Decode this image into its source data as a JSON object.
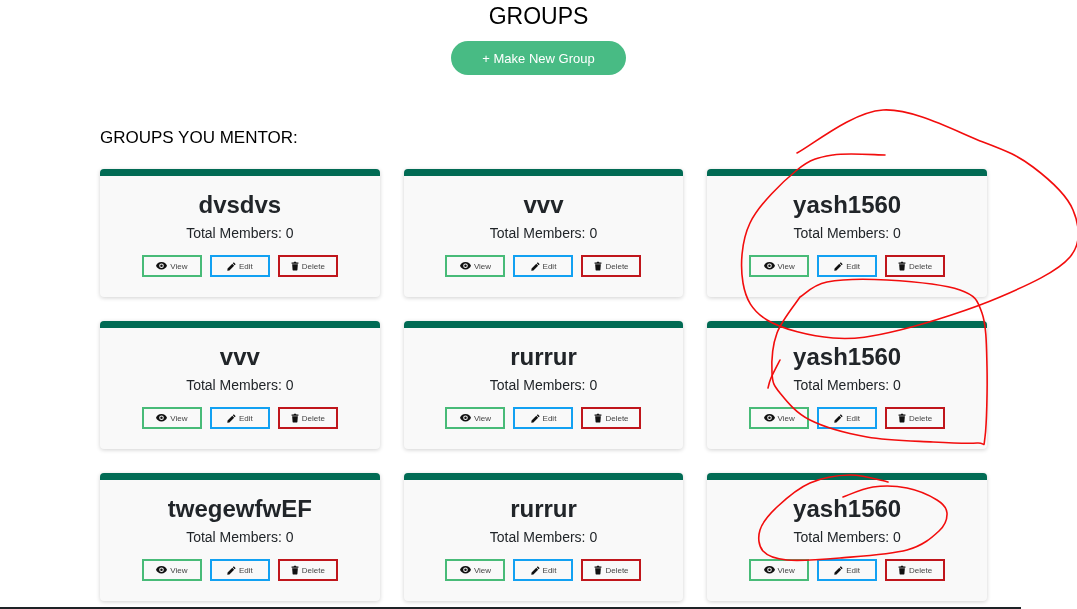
{
  "page": {
    "title": "GROUPS",
    "create_button": "+ Make New Group"
  },
  "section": {
    "heading": "GROUPS YOU MENTOR:"
  },
  "groups": [
    {
      "name": "dvsdvs",
      "members": "Total Members: 0",
      "circled": false,
      "actions": [
        {
          "kind": "view",
          "label": "View"
        },
        {
          "kind": "edit",
          "label": "Edit"
        },
        {
          "kind": "delete",
          "label": "Delete"
        }
      ]
    },
    {
      "name": "vvv",
      "members": "Total Members: 0",
      "circled": false,
      "actions": [
        {
          "kind": "view",
          "label": "View"
        },
        {
          "kind": "edit",
          "label": "Edit"
        },
        {
          "kind": "delete",
          "label": "Delete"
        }
      ]
    },
    {
      "name": "yash1560",
      "members": "Total Members: 0",
      "circled": true,
      "actions": [
        {
          "kind": "view",
          "label": "View"
        },
        {
          "kind": "edit",
          "label": "Edit"
        },
        {
          "kind": "delete",
          "label": "Delete"
        }
      ]
    },
    {
      "name": "vvv",
      "members": "Total Members: 0",
      "circled": false,
      "actions": [
        {
          "kind": "view",
          "label": "View"
        },
        {
          "kind": "edit",
          "label": "Edit"
        },
        {
          "kind": "delete",
          "label": "Delete"
        }
      ]
    },
    {
      "name": "rurrur",
      "members": "Total Members: 0",
      "circled": false,
      "actions": [
        {
          "kind": "view",
          "label": "View"
        },
        {
          "kind": "edit",
          "label": "Edit"
        },
        {
          "kind": "delete",
          "label": "Delete"
        }
      ]
    },
    {
      "name": "yash1560",
      "members": "Total Members: 0",
      "circled": true,
      "actions": [
        {
          "kind": "view",
          "label": "View"
        },
        {
          "kind": "edit",
          "label": "Edit"
        },
        {
          "kind": "delete",
          "label": "Delete"
        }
      ]
    },
    {
      "name": "twegewfwEF",
      "members": "Total Members: 0",
      "circled": false,
      "actions": [
        {
          "kind": "view",
          "label": "View"
        },
        {
          "kind": "edit",
          "label": "Edit"
        },
        {
          "kind": "delete",
          "label": "Delete"
        }
      ]
    },
    {
      "name": "rurrur",
      "members": "Total Members: 0",
      "circled": false,
      "actions": [
        {
          "kind": "view",
          "label": "View"
        },
        {
          "kind": "edit",
          "label": "Edit"
        },
        {
          "kind": "delete",
          "label": "Delete"
        }
      ]
    },
    {
      "name": "yash1560",
      "members": "Total Members: 0",
      "circled": true,
      "actions": [
        {
          "kind": "view",
          "label": "View"
        },
        {
          "kind": "edit",
          "label": "Edit"
        },
        {
          "kind": "delete",
          "label": "Delete"
        }
      ]
    }
  ]
}
